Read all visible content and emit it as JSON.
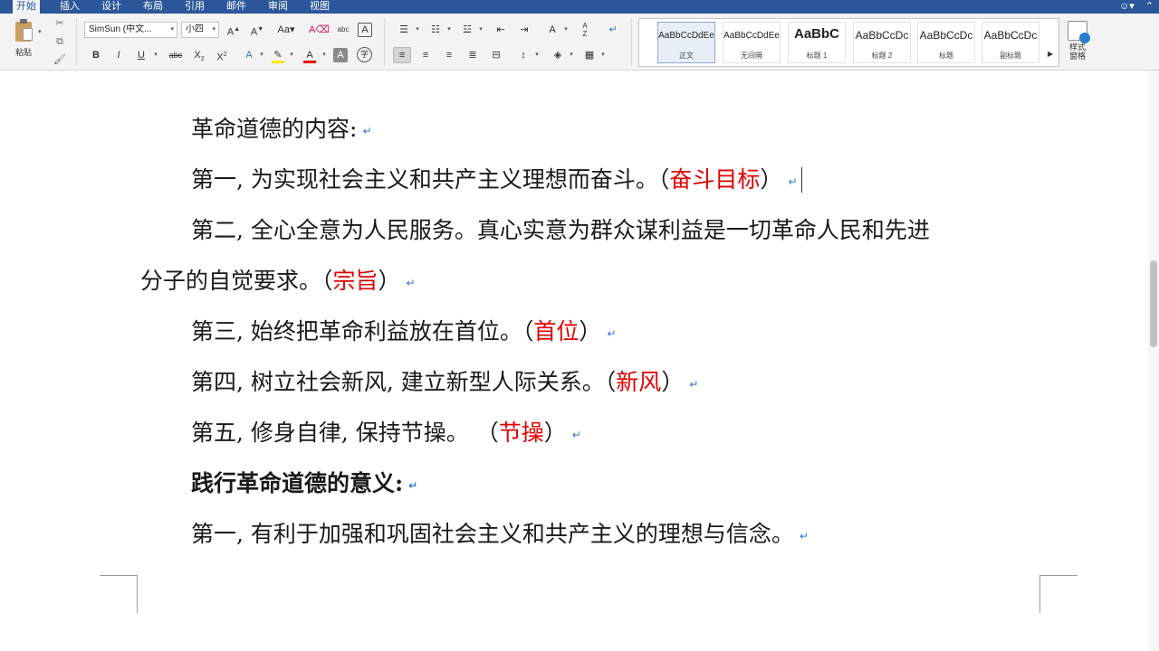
{
  "menu": {
    "tabs": [
      "开始",
      "插入",
      "设计",
      "布局",
      "引用",
      "邮件",
      "审阅",
      "视图"
    ],
    "active_tab": 0
  },
  "ribbon": {
    "paste_label": "粘贴",
    "font_name": "SimSun (中文...",
    "font_size": "小四",
    "buttons": {
      "grow": "A",
      "shrink": "A",
      "change_case": "Aa",
      "clear_format": "A",
      "phonetic": "abc",
      "char_border": "A",
      "bold": "B",
      "italic": "I",
      "underline": "U",
      "strike": "abc",
      "subscript": "X",
      "sub_2": "2",
      "superscript": "X",
      "sup_2": "2",
      "text_effect": "A",
      "font_color": "A",
      "char_shade": "A",
      "enclose": "字",
      "sort": "A",
      "sort_z": "Z"
    },
    "styles": [
      {
        "sample": "AaBbCcDdEe",
        "name": "正文"
      },
      {
        "sample": "AaBbCcDdEe",
        "name": "无间隔"
      },
      {
        "sample": "AaBbC",
        "name": "标题 1"
      },
      {
        "sample": "AaBbCcDc",
        "name": "标题 2"
      },
      {
        "sample": "AaBbCcDc",
        "name": "标题"
      },
      {
        "sample": "AaBbCcDc",
        "name": "副标题"
      }
    ],
    "style_pane_label_1": "样式",
    "style_pane_label_2": "窗格"
  },
  "document": {
    "lines": [
      {
        "text": "革命道德的内容:",
        "red": ""
      },
      {
        "text": "第一, 为实现社会主义和共产主义理想而奋斗。（",
        "red": "奋斗目标",
        "tail": "）"
      },
      {
        "text": "第二, 全心全意为人民服务。真心实意为群众谋利益是一切革命人民和先进",
        "red": ""
      },
      {
        "text": "分子的自觉要求。（",
        "red": "宗旨",
        "tail": "）"
      },
      {
        "text": "第三, 始终把革命利益放在首位。（",
        "red": "首位",
        "tail": "）"
      },
      {
        "text": "第四, 树立社会新风, 建立新型人际关系。（",
        "red": "新风",
        "tail": "）"
      },
      {
        "text": "第五, 修身自律, 保持节操。 （",
        "red": "节操",
        "tail": "）"
      },
      {
        "text": "践行革命道德的意义:",
        "red": ""
      },
      {
        "text": "第一, 有利于加强和巩固社会主义和共产主义的理想与信念。",
        "red": ""
      }
    ],
    "paragraph_mark": "↵"
  },
  "colors": {
    "accent": "#2b579a",
    "highlight_red": "#e00000",
    "paragraph_mark": "#2e75d1"
  }
}
